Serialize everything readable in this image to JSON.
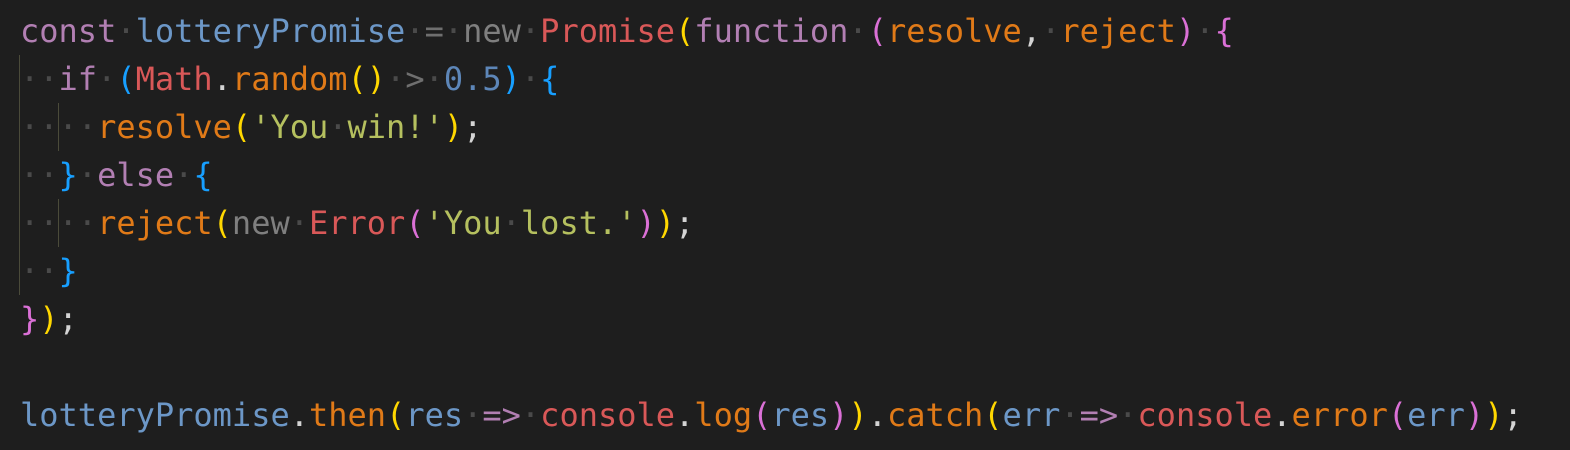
{
  "editor": {
    "language": "javascript",
    "theme_background": "#1e1e1e",
    "lines": [
      [
        {
          "t": "const",
          "c": "tok-kw"
        },
        {
          "t": "·",
          "c": "ws"
        },
        {
          "t": "lotteryPromise",
          "c": "tok-id"
        },
        {
          "t": "·",
          "c": "ws"
        },
        {
          "t": "=",
          "c": "tok-op"
        },
        {
          "t": "·",
          "c": "ws"
        },
        {
          "t": "new",
          "c": "tok-new"
        },
        {
          "t": "·",
          "c": "ws"
        },
        {
          "t": "Promise",
          "c": "tok-class"
        },
        {
          "t": "(",
          "c": "b1"
        },
        {
          "t": "function",
          "c": "tok-kw"
        },
        {
          "t": "·",
          "c": "ws"
        },
        {
          "t": "(",
          "c": "b2"
        },
        {
          "t": "resolve",
          "c": "tok-param"
        },
        {
          "t": ",",
          "c": "tok-punc"
        },
        {
          "t": "·",
          "c": "ws"
        },
        {
          "t": "reject",
          "c": "tok-param"
        },
        {
          "t": ")",
          "c": "b2"
        },
        {
          "t": "·",
          "c": "ws"
        },
        {
          "t": "{",
          "c": "b2"
        }
      ],
      [
        {
          "t": "··",
          "c": "ws"
        },
        {
          "t": "if",
          "c": "tok-kw"
        },
        {
          "t": "·",
          "c": "ws"
        },
        {
          "t": "(",
          "c": "b3"
        },
        {
          "t": "Math",
          "c": "tok-class"
        },
        {
          "t": ".",
          "c": "tok-punc"
        },
        {
          "t": "random",
          "c": "tok-fn"
        },
        {
          "t": "()",
          "c": "b1"
        },
        {
          "t": "·",
          "c": "ws"
        },
        {
          "t": ">",
          "c": "tok-op"
        },
        {
          "t": "·",
          "c": "ws"
        },
        {
          "t": "0.5",
          "c": "tok-num"
        },
        {
          "t": ")",
          "c": "b3"
        },
        {
          "t": "·",
          "c": "ws"
        },
        {
          "t": "{",
          "c": "b3"
        }
      ],
      [
        {
          "t": "····",
          "c": "ws"
        },
        {
          "t": "resolve",
          "c": "tok-fn"
        },
        {
          "t": "(",
          "c": "b1"
        },
        {
          "t": "'You",
          "c": "tok-str"
        },
        {
          "t": "·",
          "c": "ws"
        },
        {
          "t": "win!'",
          "c": "tok-str"
        },
        {
          "t": ")",
          "c": "b1"
        },
        {
          "t": ";",
          "c": "tok-punc"
        }
      ],
      [
        {
          "t": "··",
          "c": "ws"
        },
        {
          "t": "}",
          "c": "b3"
        },
        {
          "t": "·",
          "c": "ws"
        },
        {
          "t": "else",
          "c": "tok-kw"
        },
        {
          "t": "·",
          "c": "ws"
        },
        {
          "t": "{",
          "c": "b3"
        }
      ],
      [
        {
          "t": "····",
          "c": "ws"
        },
        {
          "t": "reject",
          "c": "tok-fn"
        },
        {
          "t": "(",
          "c": "b1"
        },
        {
          "t": "new",
          "c": "tok-new"
        },
        {
          "t": "·",
          "c": "ws"
        },
        {
          "t": "Error",
          "c": "tok-class"
        },
        {
          "t": "(",
          "c": "b2"
        },
        {
          "t": "'You",
          "c": "tok-str"
        },
        {
          "t": "·",
          "c": "ws"
        },
        {
          "t": "lost.'",
          "c": "tok-str"
        },
        {
          "t": ")",
          "c": "b2"
        },
        {
          "t": ")",
          "c": "b1"
        },
        {
          "t": ";",
          "c": "tok-punc"
        }
      ],
      [
        {
          "t": "··",
          "c": "ws"
        },
        {
          "t": "}",
          "c": "b3"
        }
      ],
      [
        {
          "t": "}",
          "c": "b2"
        },
        {
          "t": ")",
          "c": "b1"
        },
        {
          "t": ";",
          "c": "tok-punc"
        }
      ],
      [],
      [
        {
          "t": "lotteryPromise",
          "c": "tok-id"
        },
        {
          "t": ".",
          "c": "tok-punc"
        },
        {
          "t": "then",
          "c": "tok-fn"
        },
        {
          "t": "(",
          "c": "b1"
        },
        {
          "t": "res",
          "c": "tok-id"
        },
        {
          "t": "·",
          "c": "ws"
        },
        {
          "t": "=>",
          "c": "tok-kw"
        },
        {
          "t": "·",
          "c": "ws"
        },
        {
          "t": "console",
          "c": "tok-class"
        },
        {
          "t": ".",
          "c": "tok-punc"
        },
        {
          "t": "log",
          "c": "tok-fn"
        },
        {
          "t": "(",
          "c": "b2"
        },
        {
          "t": "res",
          "c": "tok-id"
        },
        {
          "t": ")",
          "c": "b2"
        },
        {
          "t": ")",
          "c": "b1"
        },
        {
          "t": ".",
          "c": "tok-punc"
        },
        {
          "t": "catch",
          "c": "tok-fn"
        },
        {
          "t": "(",
          "c": "b1"
        },
        {
          "t": "err",
          "c": "tok-id"
        },
        {
          "t": "·",
          "c": "ws"
        },
        {
          "t": "=>",
          "c": "tok-kw"
        },
        {
          "t": "·",
          "c": "ws"
        },
        {
          "t": "console",
          "c": "tok-class"
        },
        {
          "t": ".",
          "c": "tok-punc"
        },
        {
          "t": "error",
          "c": "tok-fn"
        },
        {
          "t": "(",
          "c": "b2"
        },
        {
          "t": "err",
          "c": "tok-id"
        },
        {
          "t": ")",
          "c": "b2"
        },
        {
          "t": ")",
          "c": "b1"
        },
        {
          "t": ";",
          "c": "tok-punc"
        }
      ]
    ]
  }
}
